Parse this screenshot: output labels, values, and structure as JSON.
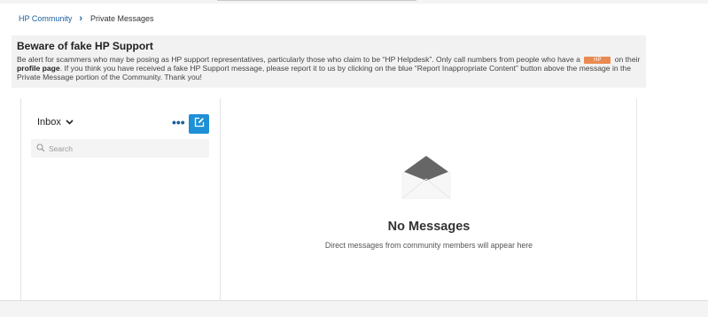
{
  "breadcrumb": {
    "home": "HP Community",
    "current": "Private Messages"
  },
  "notice": {
    "title": "Beware of fake HP Support",
    "text_part1": "Be alert for scammers who may be posing as HP support representatives, particularly those who claim to be “HP Helpdesk”. Only call numbers from people who have a",
    "badge": "HP",
    "text_part2": " on their ",
    "profile_link": "profile page",
    "text_part3": ". If you think you have received a fake HP Support message, please report it to us by clicking on the blue “Report Inappropriate Content” button above the message in the Private Message portion of the Community. Thank you!"
  },
  "sidebar": {
    "folder_label": "Inbox",
    "more_label": "•••",
    "search_placeholder": "Search"
  },
  "main": {
    "empty_title": "No Messages",
    "empty_subtitle": "Direct messages from community members will appear here"
  },
  "colors": {
    "accent": "#1e90d6",
    "link": "#1b5f9e",
    "badge": "#e98a52",
    "notice_bg": "#f2f2f2"
  },
  "icons": {
    "breadcrumb_separator": "chevron-right-icon",
    "folder_dropdown": "chevron-down-icon",
    "more": "more-dots-icon",
    "compose": "compose-icon",
    "search": "search-icon",
    "empty_state": "envelope-open-icon"
  }
}
